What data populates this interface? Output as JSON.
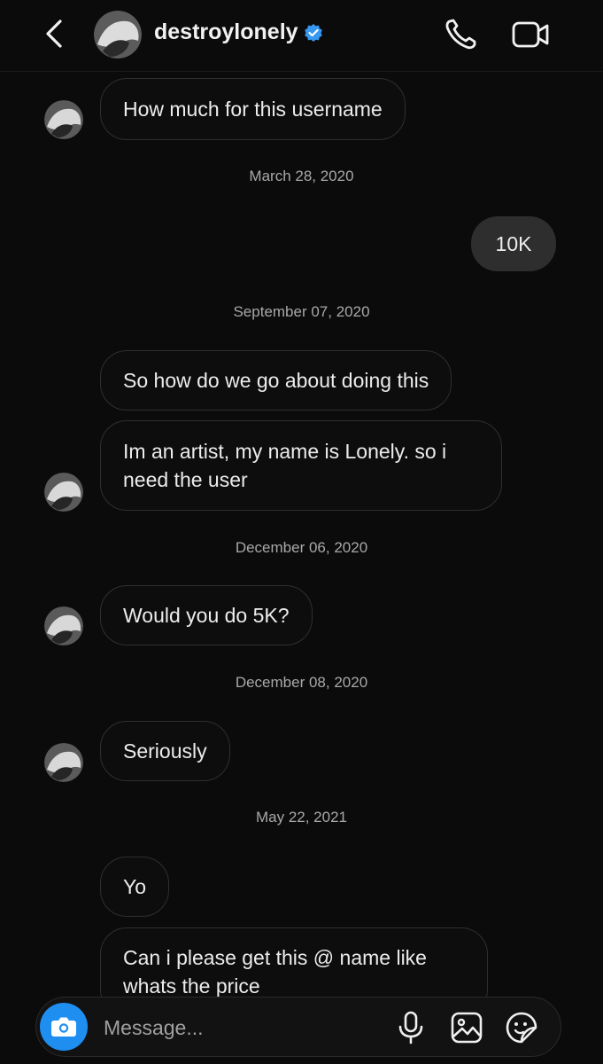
{
  "header": {
    "username": "destroylonely",
    "icons": {
      "back": "chevron-left-icon",
      "verified": "verified-badge-icon",
      "call": "phone-icon",
      "video": "video-camera-icon"
    },
    "accent_color": "#3897f0"
  },
  "messages": [
    {
      "type": "in",
      "text": "How much for this username"
    },
    {
      "type": "date",
      "text": "March 28, 2020"
    },
    {
      "type": "out",
      "text": "10K"
    },
    {
      "type": "date",
      "text": "September 07, 2020"
    },
    {
      "type": "in",
      "text": "So how do we go about doing this"
    },
    {
      "type": "in",
      "text": "Im an artist, my name is Lonely. so i need the user"
    },
    {
      "type": "date",
      "text": "December 06, 2020"
    },
    {
      "type": "in",
      "text": "Would you do 5K?"
    },
    {
      "type": "date",
      "text": "December 08, 2020"
    },
    {
      "type": "in",
      "text": "Seriously"
    },
    {
      "type": "date",
      "text": "May 22, 2021"
    },
    {
      "type": "in",
      "text": "Yo"
    },
    {
      "type": "in",
      "text": "Can i please get this @ name like whats the price"
    }
  ],
  "composer": {
    "placeholder": "Message...",
    "icons": [
      "camera-icon",
      "microphone-icon",
      "gallery-icon",
      "sticker-icon"
    ],
    "camera_color": "#1f8ef1"
  }
}
